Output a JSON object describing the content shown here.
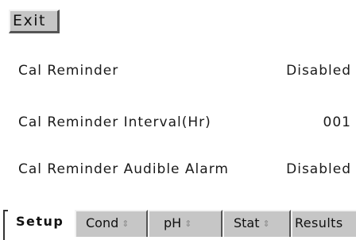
{
  "header": {
    "exit_label": "Exit"
  },
  "settings": [
    {
      "label": "Cal Reminder",
      "value": "Disabled"
    },
    {
      "label": "Cal Reminder Interval(Hr)",
      "value": "001"
    },
    {
      "label": "Cal Reminder Audible Alarm",
      "value": "Disabled"
    }
  ],
  "tabs": [
    {
      "label": "Setup",
      "active": true
    },
    {
      "label": "Cond",
      "icon": "sort-icon"
    },
    {
      "label": "pH",
      "icon": "sort-icon"
    },
    {
      "label": "Stat",
      "icon": "sort-icon"
    },
    {
      "label": "Results"
    }
  ],
  "icons": {
    "sort_glyph": "⇕"
  }
}
